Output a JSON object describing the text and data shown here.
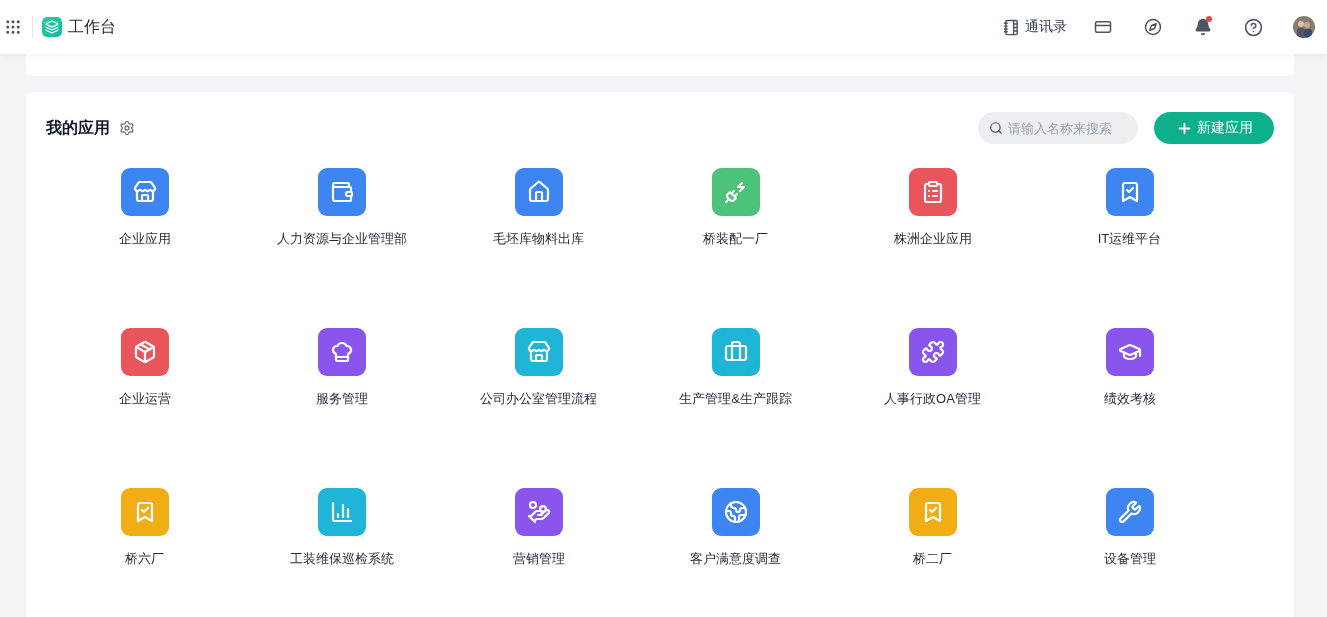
{
  "header": {
    "title": "工作台",
    "contacts": "通讯录",
    "notification_dot": true
  },
  "apps_panel": {
    "title": "我的应用",
    "search": {
      "placeholder": "请输入名称来搜索"
    },
    "new_button": "新建应用",
    "apps": [
      {
        "label": "企业应用",
        "color": "#3d85f0"
      },
      {
        "label": "人力资源与企业管理部",
        "color": "#3d85f0"
      },
      {
        "label": "毛坯库物料出库",
        "color": "#3d85f0"
      },
      {
        "label": "桥装配一厂",
        "color": "#4cc27a"
      },
      {
        "label": "株洲企业应用",
        "color": "#e9555a"
      },
      {
        "label": "IT运维平台",
        "color": "#3d85f0"
      },
      {
        "label": "企业运营",
        "color": "#e9555a"
      },
      {
        "label": "服务管理",
        "color": "#8a55ec"
      },
      {
        "label": "公司办公室管理流程",
        "color": "#1fb5d6"
      },
      {
        "label": "生产管理&生产跟踪",
        "color": "#1fb5d6"
      },
      {
        "label": "人事行政OA管理",
        "color": "#8a55ec"
      },
      {
        "label": "绩效考核",
        "color": "#8a55ec"
      },
      {
        "label": "桥六厂",
        "color": "#f2ad14"
      },
      {
        "label": "工装维保巡检系统",
        "color": "#1fb5d6"
      },
      {
        "label": "营销管理",
        "color": "#8a55ec"
      },
      {
        "label": "客户满意度调查",
        "color": "#3d85f0"
      },
      {
        "label": "桥二厂",
        "color": "#f2ad14"
      },
      {
        "label": "设备管理",
        "color": "#3d85f0"
      }
    ]
  }
}
